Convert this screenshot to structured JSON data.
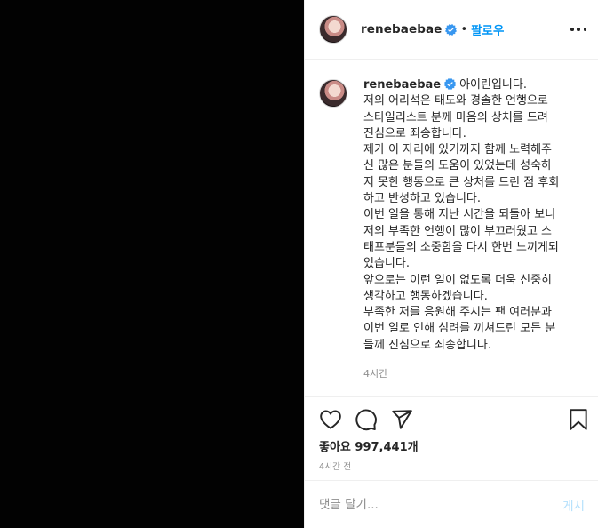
{
  "header": {
    "username": "renebaebae",
    "follow_label": "팔로우",
    "separator": "•"
  },
  "caption": {
    "username": "renebaebae",
    "lines": [
      "아이린입니다.",
      "저의 어리석은 태도와 경솔한 언행으로",
      "스타일리스트 분께 마음의 상처를 드려",
      "진심으로 죄송합니다.",
      "제가 이 자리에 있기까지 함께 노력해주",
      "신 많은 분들의 도움이 있었는데 성숙하",
      "지 못한 행동으로 큰 상처를 드린 점 후회",
      "하고 반성하고 있습니다.",
      "이번 일을 통해 지난 시간을 되돌아 보니",
      "저의 부족한 언행이 많이 부끄러웠고 스",
      "태프분들의 소중함을 다시 한번 느끼게되",
      "었습니다.",
      "앞으로는 이런 일이 없도록 더욱 신중히",
      "생각하고 행동하겠습니다.",
      "부족한 저를 응원해 주시는 팬 여러분과",
      "이번 일로 인해 심려를 끼쳐드린 모든 분",
      "들께 진심으로 죄송합니다."
    ],
    "time": "4시간"
  },
  "stats": {
    "likes": "좋아요 997,441개",
    "post_time": "4시간 전"
  },
  "comment": {
    "placeholder": "댓글 달기...",
    "post_label": "게시"
  },
  "colors": {
    "accent": "#0095f6",
    "verified": "#3897f0"
  }
}
